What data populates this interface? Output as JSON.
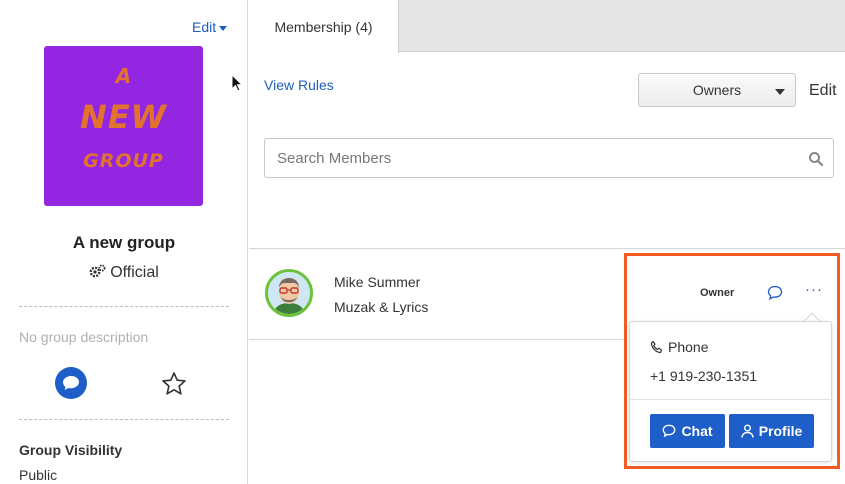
{
  "group": {
    "edit_label": "Edit",
    "logo_text": [
      "A",
      "NEW",
      "GROUP"
    ],
    "name": "A new group",
    "official_label": "Official",
    "description": "No group description",
    "visibility_label": "Group Visibility",
    "visibility_value": "Public"
  },
  "tabs": [
    {
      "label": "Membership (4)",
      "active": true
    }
  ],
  "toolbar": {
    "view_rules": "View Rules",
    "filter_selected": "Owners",
    "edit_label": "Edit"
  },
  "search": {
    "placeholder": "Search Members",
    "value": ""
  },
  "members": [
    {
      "name": "Mike Summer",
      "organization": "Muzak & Lyrics",
      "role": "Owner"
    }
  ],
  "popover": {
    "phone_label": "Phone",
    "phone_number": "+1 919-230-1351",
    "chat_button": "Chat",
    "profile_button": "Profile"
  },
  "colors": {
    "accent": "#1d5ec9",
    "highlight": "#f25b22",
    "group_image_bg": "#9326e0",
    "logo_text": "#e2732e"
  },
  "icons": [
    "caret-down-icon",
    "gear-icon",
    "chat-icon",
    "star-icon",
    "search-icon",
    "chat-bubble-icon",
    "more-icon",
    "phone-icon",
    "user-icon",
    "cursor-icon"
  ]
}
